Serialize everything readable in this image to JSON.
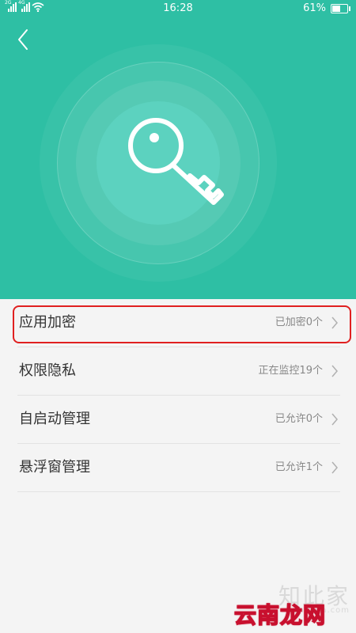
{
  "status_bar": {
    "signal_1_tag": "2G",
    "signal_2_tag": "4G",
    "time": "16:28",
    "battery_percent": "61%",
    "battery_level": 0.61
  },
  "header": {
    "background_color": "#2ebfa4",
    "icon": "key-icon"
  },
  "menu": {
    "items": [
      {
        "label": "应用加密",
        "value": "已加密0个"
      },
      {
        "label": "权限隐私",
        "value": "正在监控19个"
      },
      {
        "label": "自启动管理",
        "value": "已允许0个"
      },
      {
        "label": "悬浮窗管理",
        "value": "已允许1个"
      }
    ],
    "highlight_color": "#e02020"
  },
  "watermarks": {
    "brand_1": "知此家",
    "brand_1_sub": "zhicijia.com",
    "brand_2": "云南龙网"
  }
}
